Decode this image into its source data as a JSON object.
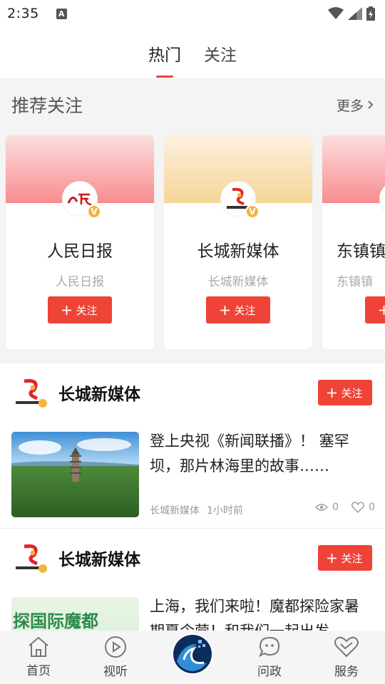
{
  "status_bar": {
    "time": "2:35",
    "notification_glyph": "A"
  },
  "top_tabs": [
    {
      "label": "热门",
      "active": true
    },
    {
      "label": "关注",
      "active": false
    }
  ],
  "recommend": {
    "title": "推荐关注",
    "more": "更多",
    "cards": [
      {
        "name": "人民日报",
        "subtitle": "人民日报",
        "follow": "关注",
        "banner": "red",
        "logo": "renmin-logo"
      },
      {
        "name": "长城新媒体",
        "subtitle": "长城新媒体",
        "follow": "关注",
        "banner": "gold",
        "logo": "changcheng-logo"
      },
      {
        "name": "东镇镇",
        "subtitle": "东镇镇",
        "follow": "关注",
        "banner": "red",
        "logo": "generic-logo"
      }
    ]
  },
  "feed": [
    {
      "account": "长城新媒体",
      "follow": "关注",
      "title": "登上央视《新闻联播》！ 塞罕坝，那片林海里的故事……",
      "source": "长城新媒体",
      "time": "1小时前",
      "views": "0",
      "likes": "0",
      "thumb": "forest-pagoda"
    },
    {
      "account": "长城新媒体",
      "follow": "关注",
      "title": "上海，我们来啦！魔都探险家暑期夏令营！和我们一起出发",
      "thumb": "poster",
      "thumb_text": "探国际魔都"
    }
  ],
  "bottom_nav": [
    {
      "label": "首页",
      "icon": "home-icon"
    },
    {
      "label": "视听",
      "icon": "play-icon"
    },
    {
      "label": "",
      "icon": "center-wave-logo"
    },
    {
      "label": "问政",
      "icon": "chat-icon"
    },
    {
      "label": "服务",
      "icon": "heart-icon"
    }
  ],
  "colors": {
    "accent": "#ef4338",
    "badge": "#f4b53f"
  }
}
